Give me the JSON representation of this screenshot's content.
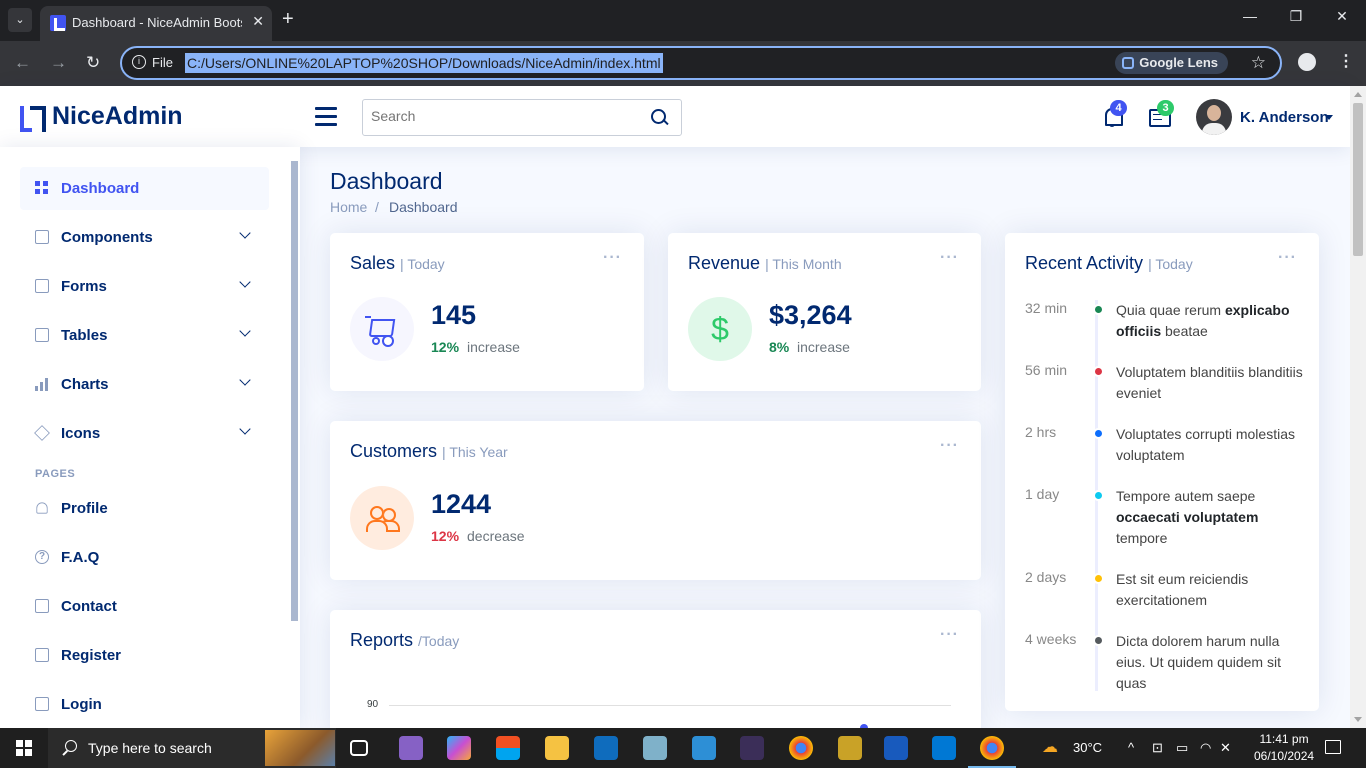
{
  "browser": {
    "tab_title": "Dashboard - NiceAdmin Bootst",
    "omnibox_scheme": "File",
    "url": "C:/Users/ONLINE%20LAPTOP%20SHOP/Downloads/NiceAdmin/index.html",
    "lens_label": "Google Lens"
  },
  "header": {
    "logo": "NiceAdmin",
    "search_placeholder": "Search",
    "notifications_count": "4",
    "messages_count": "3",
    "user_name": "K. Anderson"
  },
  "sidebar": {
    "items": [
      {
        "label": "Dashboard",
        "icon": "grid-icon",
        "active": true
      },
      {
        "label": "Components",
        "icon": "menu-icon"
      },
      {
        "label": "Forms",
        "icon": "journal-icon"
      },
      {
        "label": "Tables",
        "icon": "table-icon"
      },
      {
        "label": "Charts",
        "icon": "bar-chart-icon"
      },
      {
        "label": "Icons",
        "icon": "gem-icon"
      }
    ],
    "pages_heading": "PAGES",
    "pages": [
      {
        "label": "Profile",
        "icon": "person-icon"
      },
      {
        "label": "F.A.Q",
        "icon": "question-circle-icon"
      },
      {
        "label": "Contact",
        "icon": "envelope-icon"
      },
      {
        "label": "Register",
        "icon": "card-list-icon"
      },
      {
        "label": "Login",
        "icon": "box-arrow-in-right-icon"
      }
    ]
  },
  "page": {
    "title": "Dashboard",
    "breadcrumb": [
      "Home",
      "/",
      "Dashboard"
    ]
  },
  "cards": {
    "sales": {
      "title": "Sales",
      "period": "| Today",
      "value": "145",
      "pct": "12%",
      "trend": "increase",
      "accent": "#4154f1"
    },
    "revenue": {
      "title": "Revenue",
      "period": "| This Month",
      "value": "$3,264",
      "pct": "8%",
      "trend": "increase",
      "accent": "#2eca6a"
    },
    "customers": {
      "title": "Customers",
      "period": "| This Year",
      "value": "1244",
      "pct": "12%",
      "trend": "decrease",
      "accent": "#ff771d"
    },
    "reports": {
      "title": "Reports",
      "period": "/Today"
    }
  },
  "activity": {
    "title": "Recent Activity",
    "period": "| Today",
    "items": [
      {
        "time": "32 min",
        "color": "#198754",
        "pre": "Quia quae rerum ",
        "bold": "explicabo officiis",
        "post": " beatae"
      },
      {
        "time": "56 min",
        "color": "#dc3545",
        "pre": "Voluptatem blanditiis blanditiis eveniet",
        "bold": "",
        "post": ""
      },
      {
        "time": "2 hrs",
        "color": "#0d6efd",
        "pre": "Voluptates corrupti molestias voluptatem",
        "bold": "",
        "post": ""
      },
      {
        "time": "1 day",
        "color": "#0dcaf0",
        "pre": "Tempore autem saepe ",
        "bold": "occaecati voluptatem",
        "post": " tempore"
      },
      {
        "time": "2 days",
        "color": "#ffc107",
        "pre": "Est sit eum reiciendis exercitationem",
        "bold": "",
        "post": ""
      },
      {
        "time": "4 weeks",
        "color": "#555a5e",
        "pre": "Dicta dolorem harum nulla eius. Ut quidem quidem sit quas",
        "bold": "",
        "post": ""
      }
    ]
  },
  "chart_data": {
    "type": "line",
    "title": "Reports",
    "yticks_visible": [
      90
    ],
    "series": []
  },
  "taskbar": {
    "search_text": "Type here to search",
    "temperature": "30°C",
    "time": "11:41 pm",
    "date": "06/10/2024"
  }
}
